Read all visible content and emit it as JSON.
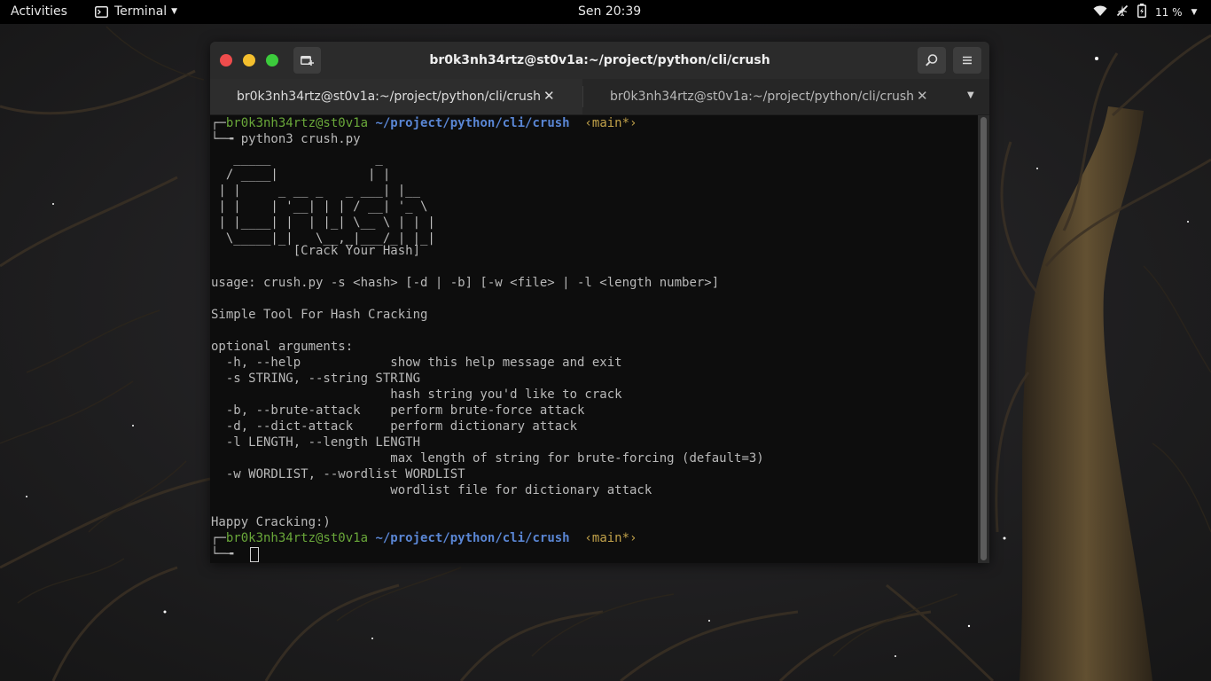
{
  "topbar": {
    "activities": "Activities",
    "app_name": "Terminal",
    "clock": "Sen 20:39",
    "battery": "11 %"
  },
  "window": {
    "title": "br0k3nh34rtz@st0v1a:~/project/python/cli/crush",
    "tabs": [
      {
        "label": "br0k3nh34rtz@st0v1a:~/project/python/cli/crush",
        "close": "✕"
      },
      {
        "label": "br0k3nh34rtz@st0v1a:~/project/python/cli/crush",
        "close": "✕"
      }
    ]
  },
  "terminal": {
    "prompt_user_host": "br0k3nh34rtz@st0v1a",
    "prompt_path": "~/project/python/cli/crush",
    "prompt_branch": "‹main*›",
    "command": "python3 crush.py",
    "ascii_art": "   _____              _     \n  / ____|            | |    \n | |     _ __ _   _ ___| |__  \n | |    | '__| | | / __| '_ \\ \n | |____| |  | |_| \\__ \\ | | |\n  \\_____|_|   \\__,_|___/_| |_|",
    "tagline": "           [Crack Your Hash]",
    "usage": "usage: crush.py -s <hash> [-d | -b] [-w <file> | -l <length number>]",
    "description": "Simple Tool For Hash Cracking",
    "optional_header": "optional arguments:",
    "args": [
      "  -h, --help            show this help message and exit",
      "  -s STRING, --string STRING",
      "                        hash string you'd like to crack",
      "  -b, --brute-attack    perform brute-force attack",
      "  -d, --dict-attack     perform dictionary attack",
      "  -l LENGTH, --length LENGTH",
      "                        max length of string for brute-forcing (default=3)",
      "  -w WORDLIST, --wordlist WORDLIST",
      "                        wordlist file for dictionary attack"
    ],
    "footer": "Happy Cracking:)"
  },
  "colors": {
    "prompt_green": "#6aa83a",
    "path_blue": "#5a86d4",
    "branch_yellow": "#c2a24a",
    "close_red": "#ee4c4c",
    "min_yellow": "#f4bf2e",
    "max_green": "#3ccb3c"
  },
  "icons": {
    "app": "terminal-icon",
    "wifi": "wifi-icon",
    "airplane": "airplane-icon",
    "battery": "battery-icon",
    "search": "search-icon",
    "menu": "hamburger-menu-icon",
    "newtab": "new-tab-icon"
  }
}
